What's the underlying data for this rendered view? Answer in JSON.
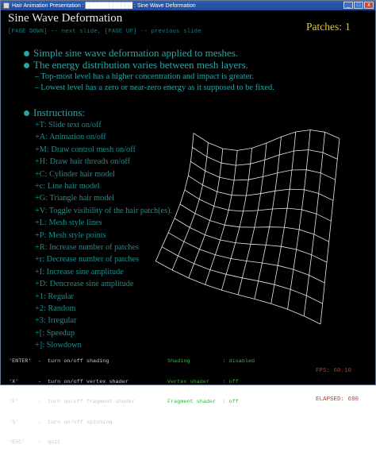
{
  "window": {
    "title": "Hair Animation Presentation : ████████████ : Sine Wave Deformation",
    "controls": [
      "_",
      "□",
      "x"
    ]
  },
  "slide": {
    "title": "Sine Wave Deformation",
    "nav_hint": "[PAGE DOWN] -- next slide, [PAGE UP] -- previous slide",
    "patches_label": "Patches:",
    "patches_value": "1"
  },
  "bullets": [
    {
      "text": "Simple sine wave deformation applied to meshes.",
      "level": 1
    },
    {
      "text": "The energy distribution varies between mesh layers.",
      "level": 1
    },
    {
      "text": "Top-most level has a higher concentration and impact is greater.",
      "level": 2
    },
    {
      "text": "Lowest level has a zero or near-zero energy as it supposed to be fixed.",
      "level": 2
    }
  ],
  "instructions": {
    "heading": "Instructions:",
    "items": [
      "+T: Slide text on/off",
      "+A: Animation on/off",
      "+M: Draw control mesh on/off",
      "+H: Draw hair threads on/off",
      "+C: Cylinder hair model",
      "+c: Line hair model",
      "+G: Triangle hair model",
      "+V: Toggle visibility of the hair patch(es).",
      "+L: Mesh style lines",
      "+P: Mesh style points",
      "+R: Increase number of patches",
      "+r: Decrease number of patches",
      "+I: Increase sine amplitude",
      "+D: Dencrease sine amplitude",
      "+1: Regular",
      "+2: Random",
      "+3: Irregular",
      "+[: Speedup",
      "+]: Slowdown"
    ]
  },
  "key_bindings": [
    "'ENTER'  -  turn on/off shading",
    "'X'      -  turn on/off vertex shader",
    "'F'      -  turn on/off fragment shader",
    "'S'      -  turn on/off spinning",
    "'ESC'    -  quit"
  ],
  "shader_states": [
    "Shading          : disabled",
    "Vertex shader    : off",
    "Fragment shader  : off"
  ],
  "stats": {
    "fps": "FPS: 60.10",
    "elapsed": "ELAPSED: 690"
  },
  "colors": {
    "background": "#000000",
    "text_teal": "#2aa5a5",
    "patches_yellow": "#e0c44a",
    "state_green": "#3cb043",
    "fps_red": "#c0392b",
    "mesh_white": "#e8e8e8"
  }
}
